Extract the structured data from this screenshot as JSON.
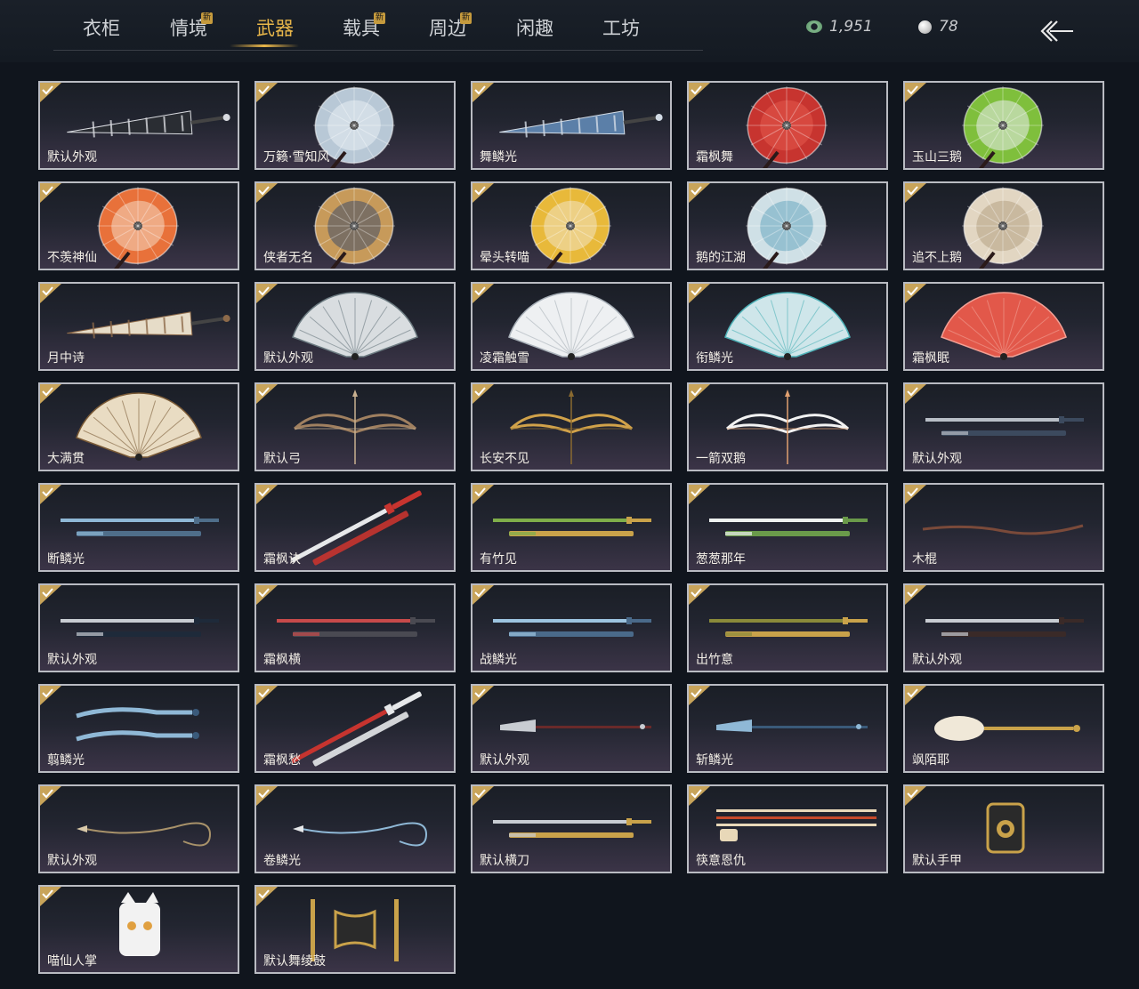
{
  "nav": {
    "tabs": [
      {
        "label": "衣柜",
        "new_badge": ""
      },
      {
        "label": "情境",
        "new_badge": "新"
      },
      {
        "label": "武器",
        "new_badge": ""
      },
      {
        "label": "载具",
        "new_badge": "新"
      },
      {
        "label": "周边",
        "new_badge": "新"
      },
      {
        "label": "闲趣",
        "new_badge": ""
      },
      {
        "label": "工坊",
        "new_badge": ""
      }
    ],
    "active_tab": "武器",
    "currency": [
      {
        "icon": "jade-coin-icon",
        "value": "1,951"
      },
      {
        "icon": "pearl-icon",
        "value": "78"
      }
    ],
    "back_icon": "back-arrow-icon"
  },
  "items": [
    {
      "name": "默认外观",
      "kind": "umbrella-closed",
      "colors": [
        "#2a2d33",
        "#d9dbe0"
      ]
    },
    {
      "name": "万籁·雪知风",
      "kind": "umbrella-open",
      "colors": [
        "#b8c8d6",
        "#e8eef4"
      ]
    },
    {
      "name": "舞鳞光",
      "kind": "umbrella-closed",
      "colors": [
        "#5b7fa8",
        "#d2dbe5"
      ]
    },
    {
      "name": "霜枫舞",
      "kind": "umbrella-open",
      "colors": [
        "#c7342f",
        "#e45a4c"
      ]
    },
    {
      "name": "玉山三鹅",
      "kind": "umbrella-open",
      "colors": [
        "#7fbf3c",
        "#e9ecef"
      ]
    },
    {
      "name": "不羡神仙",
      "kind": "umbrella-open",
      "colors": [
        "#e8713a",
        "#f4d9c1"
      ]
    },
    {
      "name": "侠者无名",
      "kind": "umbrella-open",
      "colors": [
        "#c79a5a",
        "#3f4f6a"
      ]
    },
    {
      "name": "晕头转喵",
      "kind": "umbrella-open",
      "colors": [
        "#e8b93a",
        "#f1e3c2"
      ]
    },
    {
      "name": "鹅的江湖",
      "kind": "umbrella-open",
      "colors": [
        "#cfe0e6",
        "#6aa8c0"
      ]
    },
    {
      "name": "追不上鹅",
      "kind": "umbrella-open",
      "colors": [
        "#e2d6c2",
        "#b5a283"
      ]
    },
    {
      "name": "月中诗",
      "kind": "umbrella-closed",
      "colors": [
        "#e6dcc8",
        "#8d6a4a"
      ]
    },
    {
      "name": "默认外观",
      "kind": "fan",
      "colors": [
        "#d9dde0",
        "#6b7a80"
      ]
    },
    {
      "name": "凌霜触雪",
      "kind": "fan",
      "colors": [
        "#eef0f2",
        "#a8b0b8"
      ]
    },
    {
      "name": "衔鳞光",
      "kind": "fan",
      "colors": [
        "#cfe6ea",
        "#4fb2b8"
      ]
    },
    {
      "name": "霜枫眠",
      "kind": "fan",
      "colors": [
        "#e2584a",
        "#f1a095"
      ]
    },
    {
      "name": "大满贯",
      "kind": "fan",
      "colors": [
        "#e9dcc3",
        "#7a5a36"
      ]
    },
    {
      "name": "默认弓",
      "kind": "bow",
      "colors": [
        "#a08060",
        "#c8b090"
      ]
    },
    {
      "name": "长安不见",
      "kind": "bow",
      "colors": [
        "#d1a24a",
        "#8a6a30"
      ]
    },
    {
      "name": "一箭双鹅",
      "kind": "bow",
      "colors": [
        "#f2f2f2",
        "#e0a070"
      ]
    },
    {
      "name": "默认外观",
      "kind": "sword",
      "colors": [
        "#b8bec6",
        "#3c4a5e"
      ]
    },
    {
      "name": "断鳞光",
      "kind": "sword",
      "colors": [
        "#8fb8d6",
        "#4f6e8a"
      ]
    },
    {
      "name": "霜枫诀",
      "kind": "sword-diag",
      "colors": [
        "#e6e8ea",
        "#c7342f"
      ]
    },
    {
      "name": "有竹见",
      "kind": "sword",
      "colors": [
        "#7fae4a",
        "#c9a24a"
      ]
    },
    {
      "name": "葱葱那年",
      "kind": "sword",
      "colors": [
        "#eef2f0",
        "#6a9a4a"
      ]
    },
    {
      "name": "木棍",
      "kind": "stick",
      "colors": [
        "#7a4a3a",
        "#5a3528"
      ]
    },
    {
      "name": "默认外观",
      "kind": "sword",
      "colors": [
        "#c8ccd2",
        "#1e2a3a"
      ]
    },
    {
      "name": "霜枫横",
      "kind": "sword",
      "colors": [
        "#c74a4a",
        "#4a4a52"
      ]
    },
    {
      "name": "战鳞光",
      "kind": "sword",
      "colors": [
        "#9cc4e0",
        "#4a6a8a"
      ]
    },
    {
      "name": "出竹意",
      "kind": "sword",
      "colors": [
        "#8a8a3a",
        "#c9a24a"
      ]
    },
    {
      "name": "默认外观",
      "kind": "sword",
      "colors": [
        "#c8ccd2",
        "#3a2a28"
      ]
    },
    {
      "name": "翦鳞光",
      "kind": "dual-blades",
      "colors": [
        "#8fb8d6",
        "#3a5a7a"
      ]
    },
    {
      "name": "霜枫愁",
      "kind": "sword-diag",
      "colors": [
        "#c7342f",
        "#e6e8ea"
      ]
    },
    {
      "name": "默认外观",
      "kind": "glaive",
      "colors": [
        "#c8ccd2",
        "#6a2a2a"
      ]
    },
    {
      "name": "斩鳞光",
      "kind": "glaive",
      "colors": [
        "#8fb8d6",
        "#3a5a7a"
      ]
    },
    {
      "name": "飒陌耶",
      "kind": "spoon",
      "colors": [
        "#f0e8d8",
        "#c9a24a"
      ]
    },
    {
      "name": "默认外观",
      "kind": "rope-dart",
      "colors": [
        "#a8926a",
        "#d8c8a8"
      ]
    },
    {
      "name": "卷鳞光",
      "kind": "rope-dart",
      "colors": [
        "#8fb8d6",
        "#e6e8ea"
      ]
    },
    {
      "name": "默认横刀",
      "kind": "sword",
      "colors": [
        "#c8ccd2",
        "#c9a24a"
      ]
    },
    {
      "name": "筷意恩仇",
      "kind": "chopsticks",
      "colors": [
        "#e8d8b8",
        "#c74a2a"
      ]
    },
    {
      "name": "默认手甲",
      "kind": "gauntlet",
      "colors": [
        "#2a2a2a",
        "#c9a24a"
      ]
    },
    {
      "name": "喵仙人掌",
      "kind": "gauntlet-cat",
      "colors": [
        "#f2f2f2",
        "#e0a040"
      ]
    },
    {
      "name": "默认舞绫鼓",
      "kind": "drum",
      "colors": [
        "#c9a24a",
        "#2a2a2a"
      ]
    }
  ]
}
